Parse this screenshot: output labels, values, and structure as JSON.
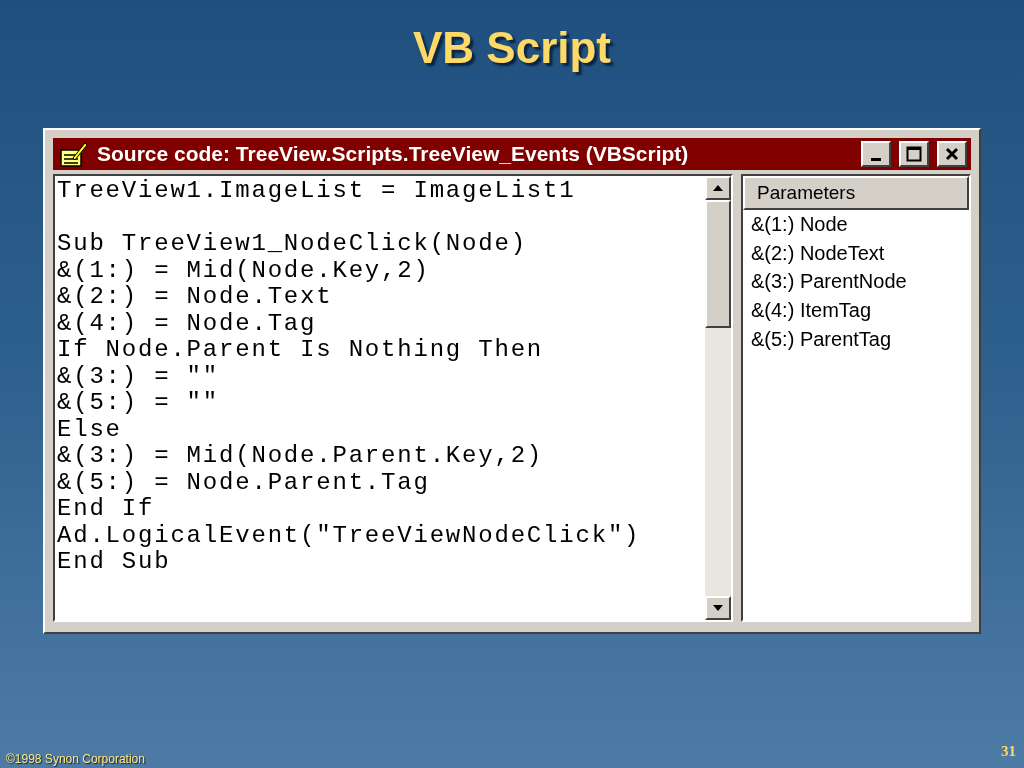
{
  "slide_title": "VB Script",
  "window": {
    "title": "Source code: TreeView.Scripts.TreeView_Events (VBScript)",
    "buttons": [
      {
        "kind": "minimize"
      },
      {
        "kind": "maximize"
      },
      {
        "kind": "close"
      }
    ]
  },
  "code": "TreeView1.ImageList = ImageList1\n\nSub TreeView1_NodeClick(Node)\n&(1:) = Mid(Node.Key,2)\n&(2:) = Node.Text\n&(4:) = Node.Tag\nIf Node.Parent Is Nothing Then\n&(3:) = \"\"\n&(5:) = \"\"\nElse\n&(3:) = Mid(Node.Parent.Key,2)\n&(5:) = Node.Parent.Tag\nEnd If\nAd.LogicalEvent(\"TreeViewNodeClick\")\nEnd Sub",
  "parameters": {
    "header": "Parameters",
    "items": [
      "&(1:) Node",
      "&(2:) NodeText",
      "&(3:) ParentNode",
      "&(4:) ItemTag",
      "&(5:) ParentTag"
    ]
  },
  "footer": {
    "copyright": "©1998 Synon Corporation",
    "page_number": "31"
  }
}
